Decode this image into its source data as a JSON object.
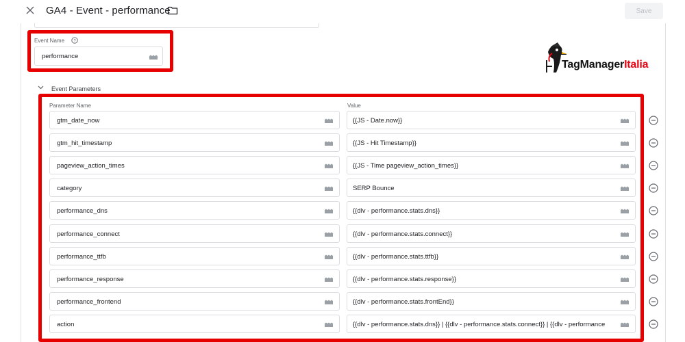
{
  "header": {
    "title": "GA4 - Event - performance",
    "save_label": "Save"
  },
  "event_name": {
    "label": "Event Name",
    "value": "performance"
  },
  "logo": {
    "text_main": "TagManager",
    "text_accent": "Italia"
  },
  "parameters": {
    "section_label": "Event Parameters",
    "name_header": "Parameter Name",
    "value_header": "Value",
    "rows": [
      {
        "name": "gtm_date_now",
        "value": "{{JS - Date.now}}"
      },
      {
        "name": "gtm_hit_timestamp",
        "value": "{{JS - Hit Timestamp}}"
      },
      {
        "name": "pageview_action_times",
        "value": "{{JS - Time pageview_action_times}}"
      },
      {
        "name": "category",
        "value": "SERP Bounce"
      },
      {
        "name": "performance_dns",
        "value": "{{dlv - performance.stats.dns}}"
      },
      {
        "name": "performance_connect",
        "value": "{{dlv - performance.stats.connect}}"
      },
      {
        "name": "performance_ttfb",
        "value": "{{dlv - performance.stats.ttfb}}"
      },
      {
        "name": "performance_response",
        "value": "{{dlv - performance.stats.response}}"
      },
      {
        "name": "performance_frontend",
        "value": "{{dlv - performance.stats.frontEnd}}"
      },
      {
        "name": "action",
        "value": "{{dlv - performance.stats.dns}} | {{dlv - performance.stats.connect}} | {{dlv - performance"
      }
    ]
  },
  "colors": {
    "highlight": "#e60000",
    "border": "#dadce0",
    "icon": "#9aa0a6",
    "logo_accent": "#e30613"
  },
  "icons": {
    "close": "close-icon",
    "folder": "folder-icon",
    "help": "help-icon",
    "variable": "variable-picker-icon",
    "remove": "remove-row-icon",
    "chevron": "chevron-down-icon"
  }
}
